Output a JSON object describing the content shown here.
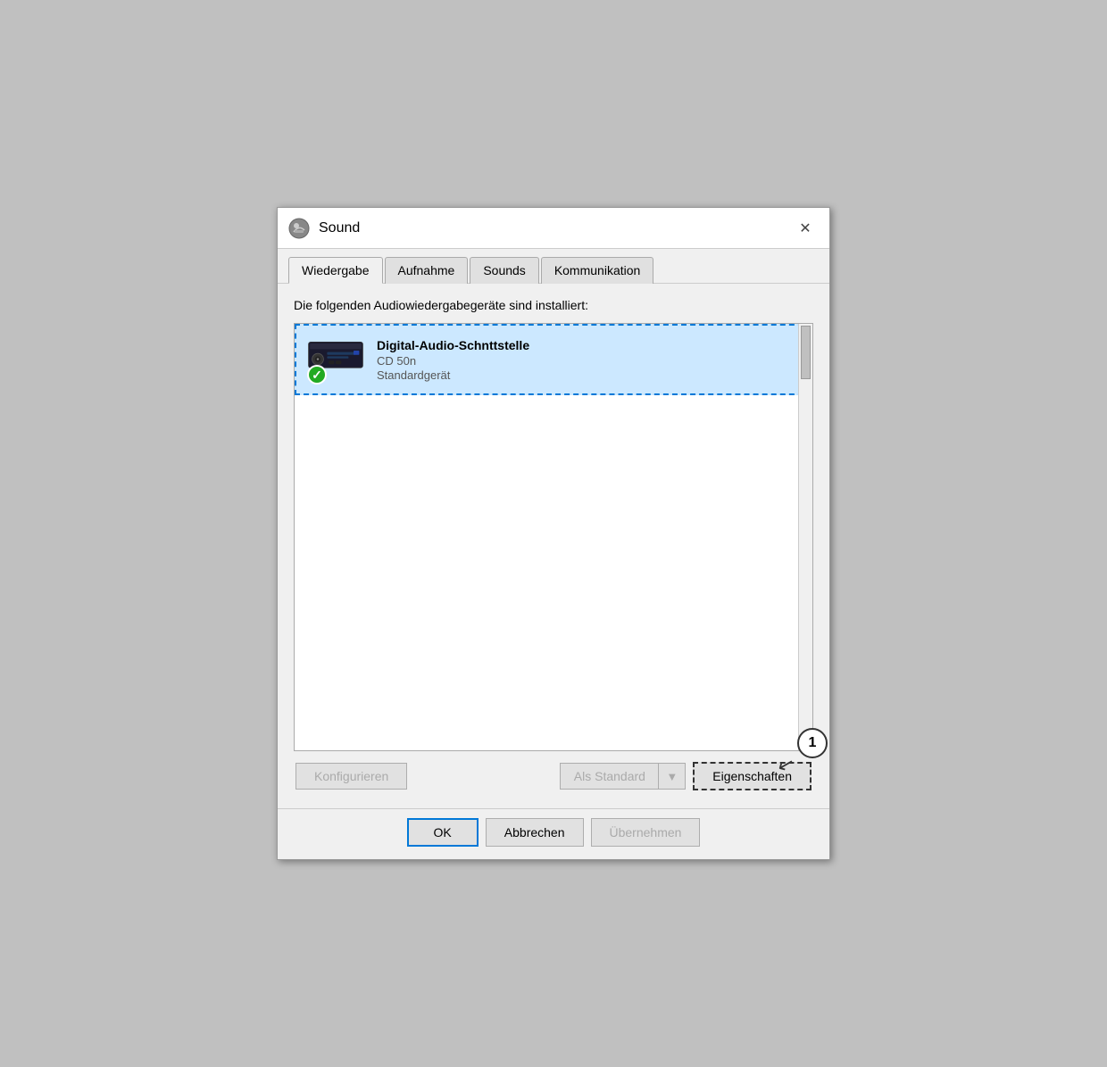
{
  "titleBar": {
    "title": "Sound",
    "closeLabel": "✕"
  },
  "tabs": [
    {
      "id": "wiedergabe",
      "label": "Wiedergabe",
      "active": true
    },
    {
      "id": "aufnahme",
      "label": "Aufnahme",
      "active": false
    },
    {
      "id": "sounds",
      "label": "Sounds",
      "active": false
    },
    {
      "id": "kommunikation",
      "label": "Kommunikation",
      "active": false
    }
  ],
  "body": {
    "description": "Die folgenden Audiowiedergabegeräte sind installiert:",
    "device": {
      "name": "Digital-Audio-Schnttstelle",
      "model": "CD 50n",
      "status": "Standardgerät",
      "statusIcon": "✓"
    }
  },
  "buttons": {
    "konfigurieren": "Konfigurieren",
    "alsStandard": "Als Standard",
    "eigenschaften": "Eigenschaften",
    "ok": "OK",
    "abbrechen": "Abbrechen",
    "ubernehmen": "Übernehmen"
  },
  "annotation": {
    "number": "1"
  }
}
